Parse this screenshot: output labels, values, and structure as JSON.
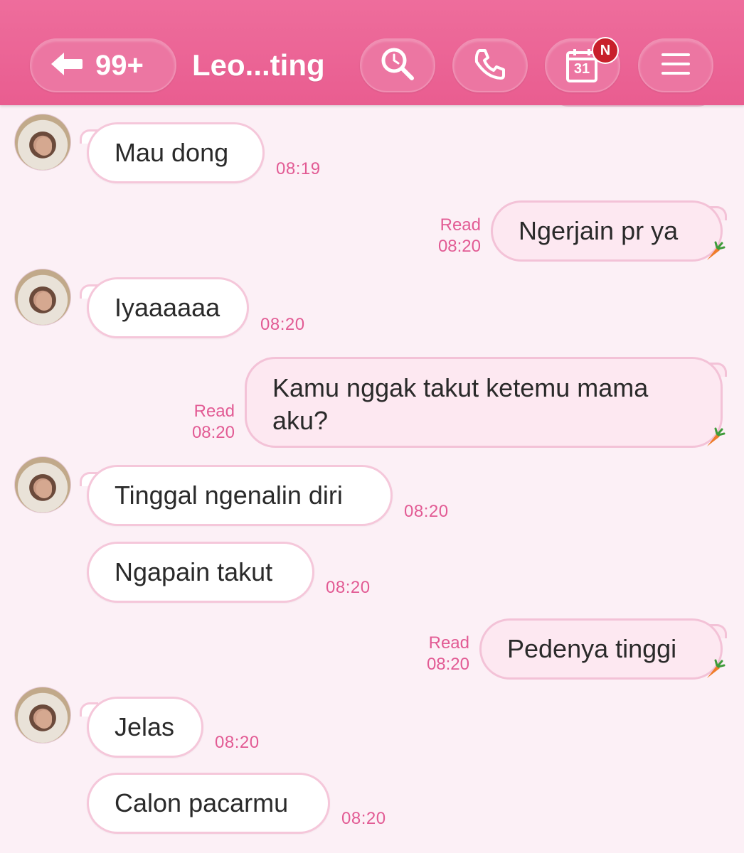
{
  "header": {
    "back_count": "99+",
    "title": "Leo...ting",
    "calendar_day": "31",
    "calendar_badge": "N"
  },
  "colors": {
    "header": "#e95d90",
    "background": "#fcf0f6",
    "incoming_bubble": "#ffffff",
    "outgoing_bubble": "#fde8f1",
    "accent_text": "#e25b94",
    "badge": "#c8202b"
  },
  "messages": [
    {
      "dir": "in",
      "text": "Mau dong",
      "time": "08:19"
    },
    {
      "dir": "out",
      "text": "Ngerjain pr ya",
      "status": "Read",
      "time": "08:20"
    },
    {
      "dir": "in",
      "text": "Iyaaaaaa",
      "time": "08:20"
    },
    {
      "dir": "out",
      "text_line1": "Kamu nggak takut ketemu mama",
      "text_line2": "aku?",
      "status": "Read",
      "time": "08:20"
    },
    {
      "dir": "in",
      "text": "Tinggal ngenalin diri",
      "time": "08:20"
    },
    {
      "dir": "in",
      "text": "Ngapain takut",
      "time": "08:20"
    },
    {
      "dir": "out",
      "text": "Pedenya tinggi",
      "status": "Read",
      "time": "08:20"
    },
    {
      "dir": "in",
      "text": "Jelas",
      "time": "08:20"
    },
    {
      "dir": "in",
      "text": "Calon pacarmu",
      "time": "08:20"
    }
  ]
}
